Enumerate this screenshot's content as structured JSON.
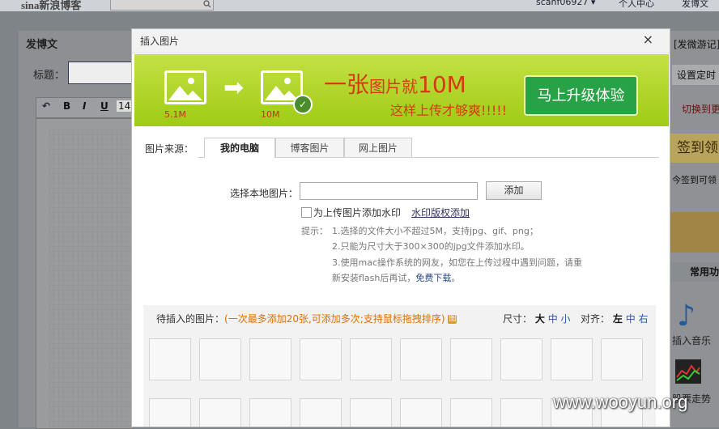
{
  "topbar": {
    "logo": "sina新浪博客",
    "username": "scanf06927 ▾",
    "personal_center": "个人中心",
    "post_blog": "发博文"
  },
  "bg": {
    "page_title": "发博文",
    "title_label": "标题：",
    "toolbar": {
      "bold": "B",
      "italic": "I",
      "underline": "U",
      "font_size": "14"
    },
    "right": {
      "post_game": "[发微游记]",
      "schedule": "设置定时",
      "switch": "切换到更",
      "sign_in": "签到领",
      "sign_hint": "今签到可领",
      "common": "常用功",
      "insert_music": "插入音乐",
      "stock": "股票走势"
    }
  },
  "dialog": {
    "title": "插入图片",
    "close": "×",
    "banner": {
      "before_size": "5.1M",
      "after_size": "10M",
      "slogan_prefix": "一张",
      "slogan_mid": "图片就",
      "slogan_big": "10M",
      "slogan2": "这样上传才够爽!!!!!",
      "upgrade_button": "马上升级体验"
    },
    "source_label": "图片来源：",
    "tabs": [
      "我的电脑",
      "博客图片",
      "网上图片"
    ],
    "select_label": "选择本地图片：",
    "file_value": "",
    "add_button": "添加",
    "watermark_checkbox": "为上传图片添加水印",
    "watermark_link": "水印版权添加",
    "tips": {
      "label": "提示：",
      "line1": "1.选择的文件大小不超过5M，支持jpg、gif、png；",
      "line2": "2.只能为尺寸大于300×300的jpg文件添加水印。",
      "line3": "3.使用mac操作系统的网友，如您在上传过程中遇到问题，请重",
      "line4_prefix": "新安装flash后再试，",
      "line4_link": "免费下载",
      "line4_suffix": "。"
    },
    "pending": {
      "label": "待插入的图片：",
      "note": "(一次最多添加20张,可添加多次;支持鼠标拖拽排序)",
      "size_label": "尺寸：",
      "sizes": [
        "大",
        "中",
        "小"
      ],
      "align_label": "对齐：",
      "aligns": [
        "左",
        "中",
        "右"
      ]
    }
  },
  "watermark": "www.wooyun.org",
  "colors": {
    "banner_green": "#a8d21c",
    "upgrade_button": "#28a246",
    "slogan_red": "#d63a10",
    "note_orange": "#e07000"
  }
}
